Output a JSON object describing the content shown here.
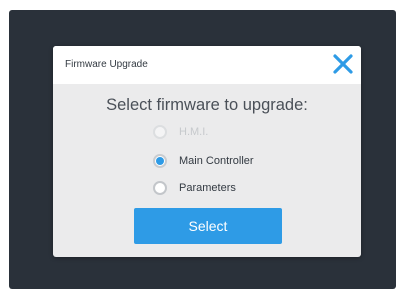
{
  "dialog": {
    "title": "Firmware Upgrade",
    "close_icon": "close-x-icon",
    "prompt": "Select firmware to upgrade:",
    "options": [
      {
        "label": "H.M.I.",
        "selected": false,
        "disabled": true
      },
      {
        "label": "Main Controller",
        "selected": true,
        "disabled": false
      },
      {
        "label": "Parameters",
        "selected": false,
        "disabled": false
      }
    ],
    "select_label": "Select"
  },
  "colors": {
    "backdrop": "#2a313a",
    "dialog_body": "#ebebec",
    "header": "#ffffff",
    "accent": "#2e9be6"
  }
}
